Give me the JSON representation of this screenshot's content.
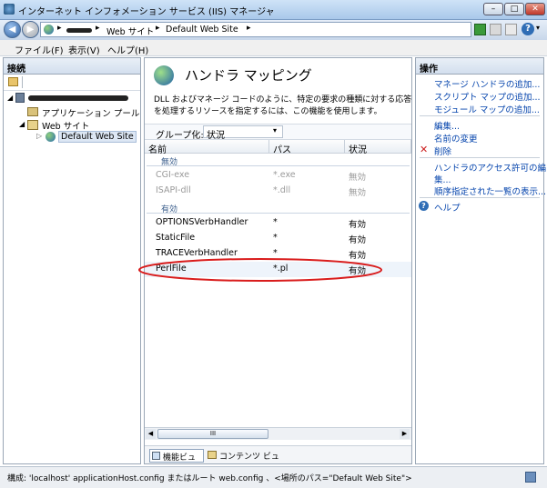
{
  "window": {
    "title": "インターネット インフォメーション サービス (IIS) マネージャ"
  },
  "address": {
    "crumbs": [
      "Web サイト",
      "Default Web Site"
    ]
  },
  "menu": {
    "file": "ファイル(F)",
    "view": "表示(V)",
    "help": "ヘルプ(H)"
  },
  "left": {
    "title": "接続",
    "tree": {
      "app_pool": "アプリケーション プール",
      "web_sites": "Web サイト",
      "default_site": "Default Web Site"
    }
  },
  "main": {
    "title": "ハンドラ マッピング",
    "description_line1": "DLL およびマネージ コードのように、特定の要求の種類に対する応答",
    "description_line2": "を処理するリソースを指定するには、この機能を使用します。",
    "group_label": "グループ化:",
    "group_value": "状況",
    "columns": [
      "名前",
      "パス",
      "状況"
    ],
    "groups": [
      {
        "label": "無効",
        "rows": [
          {
            "name": "CGI-exe",
            "path": "*.exe",
            "state": "無効"
          },
          {
            "name": "ISAPI-dll",
            "path": "*.dll",
            "state": "無効"
          }
        ]
      },
      {
        "label": "有効",
        "rows": [
          {
            "name": "OPTIONSVerbHandler",
            "path": "*",
            "state": "有効"
          },
          {
            "name": "StaticFile",
            "path": "*",
            "state": "有効"
          },
          {
            "name": "TRACEVerbHandler",
            "path": "*",
            "state": "有効"
          },
          {
            "name": "PerlFile",
            "path": "*.pl",
            "state": "有効"
          }
        ]
      }
    ],
    "scroll_thumb": "III",
    "view_tabs": {
      "features": "機能ビュー",
      "content": "コンテンツ ビュー"
    }
  },
  "actions": {
    "title": "操作",
    "add_managed": "マネージ ハンドラの追加...",
    "add_script": "スクリプト マップの追加...",
    "add_module": "モジュール マップの追加...",
    "edit": "編集...",
    "rename": "名前の変更",
    "delete": "削除",
    "edit_perm_1": "ハンドラのアクセス許可の編",
    "edit_perm_2": "集...",
    "ordered": "順序指定された一覧の表示...",
    "help": "ヘルプ"
  },
  "status": {
    "text": "構成: 'localhost' applicationHost.config またはルート web.config 、<場所のパス=\"Default Web Site\">"
  },
  "colors": {
    "highlight_ellipse": "#d91c1c",
    "link": "#0645ad",
    "disabled_text": "#9a9a9a"
  }
}
